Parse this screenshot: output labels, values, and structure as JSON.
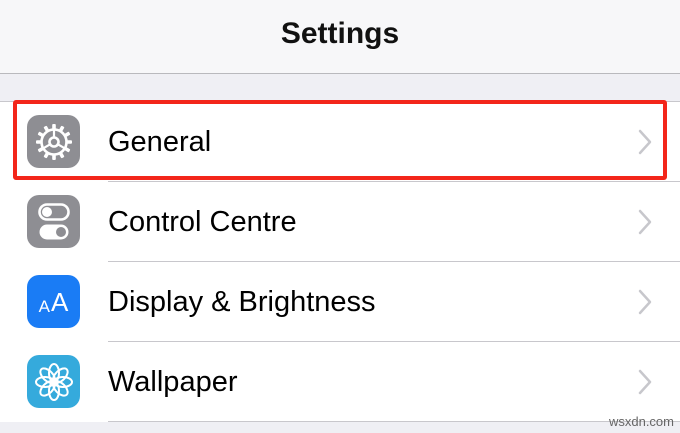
{
  "nav": {
    "title": "Settings"
  },
  "rows": [
    {
      "label": "General",
      "icon": "gear-icon",
      "icon_bg": "#8e8e93",
      "highlighted": true
    },
    {
      "label": "Control Centre",
      "icon": "toggles-icon",
      "icon_bg": "#8e8e93",
      "highlighted": false
    },
    {
      "label": "Display & Brightness",
      "icon": "text-size-icon",
      "icon_text": "AA",
      "icon_bg": "#1a7cf5",
      "highlighted": false
    },
    {
      "label": "Wallpaper",
      "icon": "flower-icon",
      "icon_bg": "#35aadc",
      "highlighted": false
    }
  ],
  "colors": {
    "highlight": "#f3261a",
    "separator": "#c8c7cc",
    "chevron": "#c7c7cc"
  },
  "watermark": "wsxdn.com"
}
